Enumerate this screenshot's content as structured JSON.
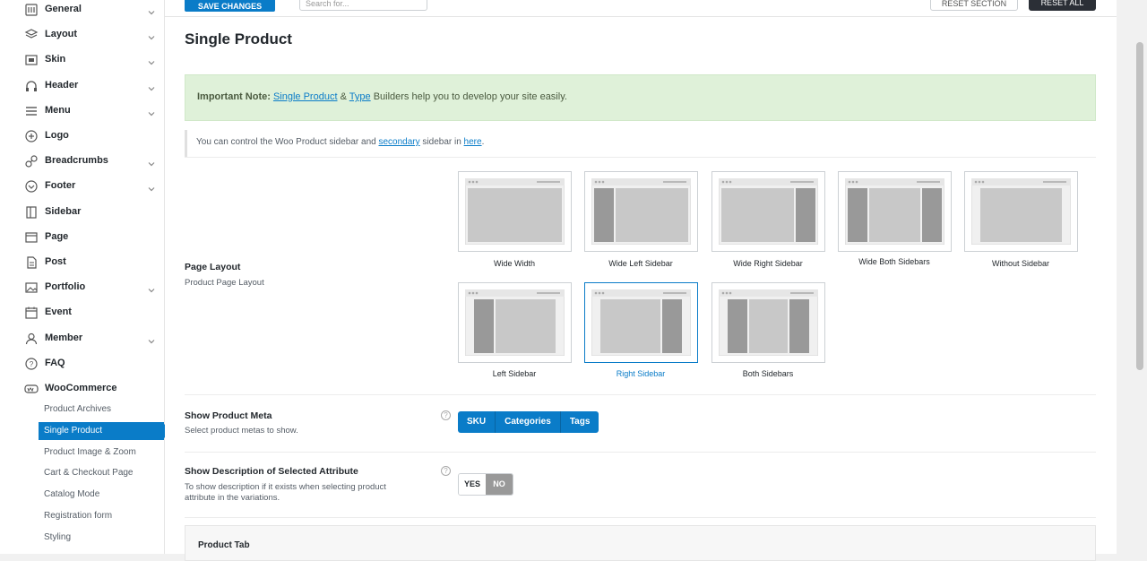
{
  "toolbar": {
    "save_label": "SAVE CHANGES",
    "search_placeholder": "Search for...",
    "reset_section_label": "RESET SECTION",
    "reset_all_label": "RESET ALL"
  },
  "sidebar": {
    "items": [
      {
        "label": "General",
        "icon": "general-icon",
        "chevron": true
      },
      {
        "label": "Layout",
        "icon": "layers-icon",
        "chevron": true
      },
      {
        "label": "Skin",
        "icon": "skin-icon",
        "chevron": true
      },
      {
        "label": "Header",
        "icon": "header-icon",
        "chevron": true
      },
      {
        "label": "Menu",
        "icon": "menu-icon",
        "chevron": true
      },
      {
        "label": "Logo",
        "icon": "logo-icon",
        "chevron": false
      },
      {
        "label": "Breadcrumbs",
        "icon": "link-icon",
        "chevron": true
      },
      {
        "label": "Footer",
        "icon": "footer-icon",
        "chevron": true
      },
      {
        "label": "Sidebar",
        "icon": "sidebar-icon",
        "chevron": false
      },
      {
        "label": "Page",
        "icon": "page-icon",
        "chevron": false
      },
      {
        "label": "Post",
        "icon": "post-icon",
        "chevron": false
      },
      {
        "label": "Portfolio",
        "icon": "portfolio-icon",
        "chevron": true
      },
      {
        "label": "Event",
        "icon": "calendar-icon",
        "chevron": false
      },
      {
        "label": "Member",
        "icon": "member-icon",
        "chevron": true
      },
      {
        "label": "FAQ",
        "icon": "question-icon",
        "chevron": false
      },
      {
        "label": "WooCommerce",
        "icon": "woocommerce-icon",
        "chevron": false
      }
    ],
    "subitems": [
      {
        "label": "Product Archives"
      },
      {
        "label": "Single Product"
      },
      {
        "label": "Product Image & Zoom"
      },
      {
        "label": "Cart & Checkout Page"
      },
      {
        "label": "Catalog Mode"
      },
      {
        "label": "Registration form"
      },
      {
        "label": "Styling"
      }
    ]
  },
  "main": {
    "title": "Single Product",
    "note": {
      "prefix": "Important Note:",
      "link1": "Single Product",
      "amp": "&",
      "link2": "Type",
      "suffix": "Builders help you to develop your site easily."
    },
    "info": {
      "part1": "You can control the Woo Product sidebar and",
      "link1": "secondary",
      "part2": "sidebar in",
      "link2": "here",
      "part3": "."
    },
    "page_layout": {
      "title": "Page Layout",
      "desc": "Product Page Layout",
      "options": [
        {
          "label": "Wide Width",
          "selected": false
        },
        {
          "label": "Wide Left Sidebar",
          "selected": false
        },
        {
          "label": "Wide Right Sidebar",
          "selected": false
        },
        {
          "label": "Wide Both Sidebars",
          "selected": false
        },
        {
          "label": "Without Sidebar",
          "selected": false
        },
        {
          "label": "Left Sidebar",
          "selected": false
        },
        {
          "label": "Right Sidebar",
          "selected": true
        },
        {
          "label": "Both Sidebars",
          "selected": false
        }
      ]
    },
    "product_meta": {
      "title": "Show Product Meta",
      "desc": "Select product metas to show.",
      "options": [
        "SKU",
        "Categories",
        "Tags"
      ]
    },
    "description_attr": {
      "title": "Show Description of Selected Attribute",
      "desc_line1": "To show description if it exists when selecting product",
      "desc_line2": "attribute in the variations.",
      "yes": "YES",
      "no": "NO",
      "value": "NO"
    },
    "product_tab": {
      "title": "Product Tab"
    },
    "help_glyph": "?"
  },
  "colors": {
    "accent": "#0a7cc8",
    "note_bg": "#dff1d9"
  }
}
